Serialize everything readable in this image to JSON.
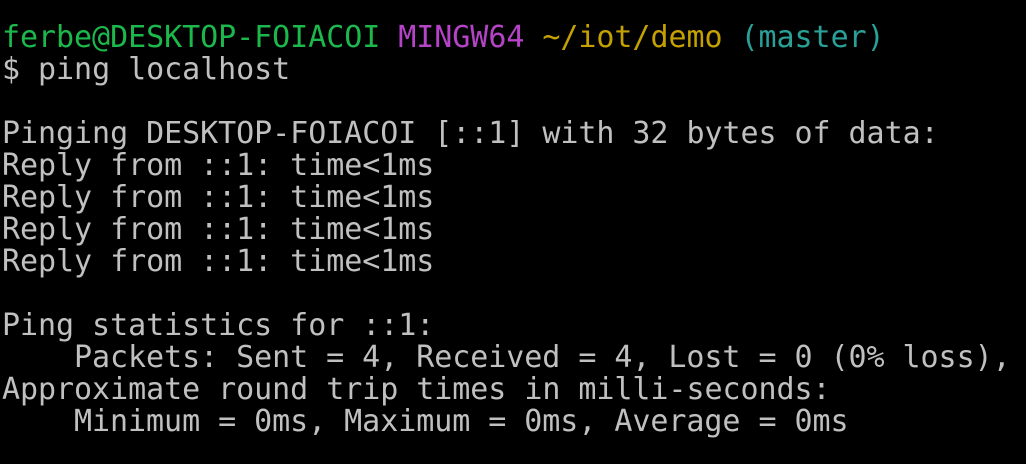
{
  "colors": {
    "background": "#000000",
    "text": "#c0c0c0",
    "user_host": "#1cb84c",
    "mingw": "#b443c6",
    "path": "#c4a000",
    "branch": "#2aa198"
  },
  "prompt": {
    "user_host": "ferbe@DESKTOP-FOIACOI",
    "system": "MINGW64",
    "path": "~/iot/demo",
    "branch": "(master)",
    "symbol": "$",
    "command": "ping localhost"
  },
  "output": {
    "header": "Pinging DESKTOP-FOIACOI [::1] with 32 bytes of data:",
    "replies": [
      "Reply from ::1: time<1ms",
      "Reply from ::1: time<1ms",
      "Reply from ::1: time<1ms",
      "Reply from ::1: time<1ms"
    ],
    "stats_header": "Ping statistics for ::1:",
    "packets": "Packets: Sent = 4, Received = 4, Lost = 0 (0% loss),",
    "rtt_header": "Approximate round trip times in milli-seconds:",
    "rtt_values": "Minimum = 0ms, Maximum = 0ms, Average = 0ms"
  }
}
